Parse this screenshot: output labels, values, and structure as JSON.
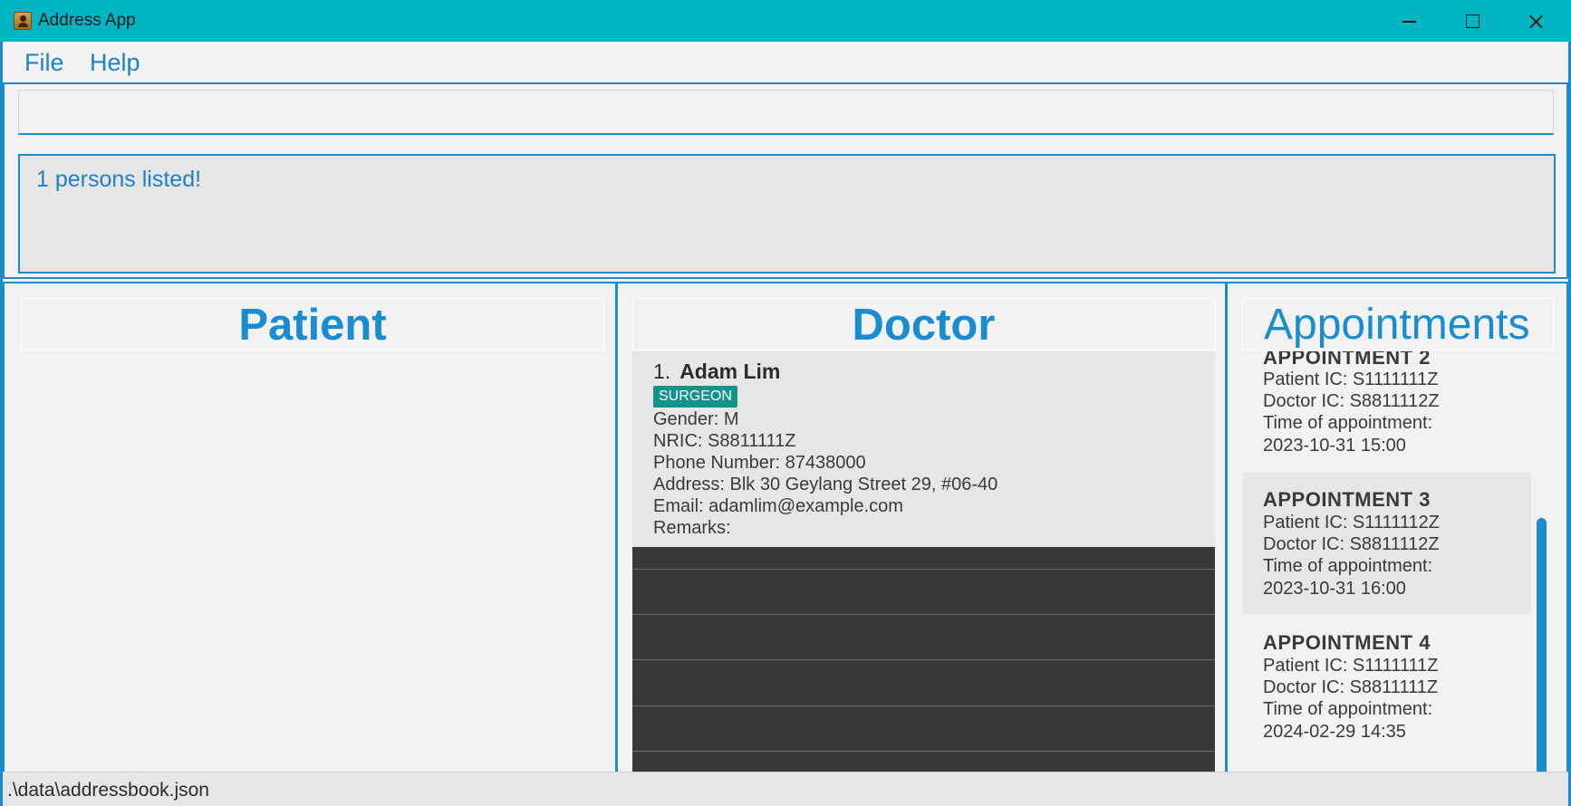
{
  "window": {
    "title": "Address App"
  },
  "menu": {
    "file": "File",
    "help": "Help"
  },
  "command": {
    "value": "",
    "placeholder": ""
  },
  "result": {
    "message": "1 persons listed!"
  },
  "panels": {
    "patient": "Patient",
    "doctor": "Doctor",
    "appointments": "Appointments"
  },
  "doctors": [
    {
      "index": "1.",
      "name": "Adam Lim",
      "tag": "SURGEON",
      "gender": "Gender: M",
      "nric": "NRIC: S8811111Z",
      "phone": "Phone Number: 87438000",
      "address": "Address: Blk 30 Geylang Street 29, #06-40",
      "email": "Email: adamlim@example.com",
      "remarks": "Remarks:"
    }
  ],
  "appointments": [
    {
      "title": "APPOINTMENT 2",
      "patient": "Patient IC: S1111111Z",
      "doctor": "Doctor IC: S8811112Z",
      "time_label": "Time of appointment:",
      "time": "2023-10-31 15:00"
    },
    {
      "title": "APPOINTMENT 3",
      "patient": "Patient IC: S1111112Z",
      "doctor": "Doctor IC: S8811112Z",
      "time_label": "Time of appointment:",
      "time": "2023-10-31 16:00"
    },
    {
      "title": "APPOINTMENT 4",
      "patient": "Patient IC: S1111111Z",
      "doctor": "Doctor IC: S8811111Z",
      "time_label": "Time of appointment:",
      "time": "2024-02-29 14:35"
    }
  ],
  "status": {
    "path": ".\\data\\addressbook.json"
  },
  "icons": {
    "app": "address-book-icon",
    "minimize": "minimize-icon",
    "maximize": "maximize-icon",
    "close": "close-icon"
  },
  "colors": {
    "titlebar": "#00b5c3",
    "accent": "#1a8ccf",
    "tag": "#13938a",
    "list_empty": "#383838"
  }
}
